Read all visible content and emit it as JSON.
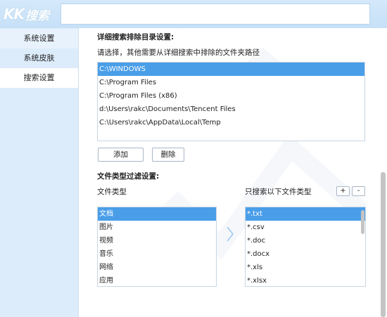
{
  "app": {
    "logo_kk": "KK",
    "logo_text": "搜索",
    "search_value": ""
  },
  "sidebar": {
    "items": [
      {
        "label": "系统设置"
      },
      {
        "label": "系统皮肤"
      },
      {
        "label": "搜索设置"
      }
    ]
  },
  "exclude": {
    "title": "详细搜索排除目录设置:",
    "hint": "请选择，其他需要从详细搜索中排除的文件夹路径",
    "paths": [
      "C:\\WINDOWS",
      "C:\\Program Files",
      "C:\\Program Files (x86)",
      "d:\\Users\\rakc\\Documents\\Tencent Files",
      "C:\\Users\\rakc\\AppData\\Local\\Temp"
    ],
    "add_label": "添加",
    "delete_label": "删除"
  },
  "filter": {
    "title": "文件类型过滤设置:",
    "left_label": "文件类型",
    "right_label": "只搜索以下文件类型",
    "plus_label": "+",
    "minus_label": "-",
    "types": [
      "文档",
      "图片",
      "视频",
      "音乐",
      "网络",
      "应用"
    ],
    "extensions": [
      "*.txt",
      "*.csv",
      "*.doc",
      "*.docx",
      "*.xls",
      "*.xlsx"
    ]
  },
  "colors": {
    "accent": "#4a9ee8",
    "sidebar_bg": "#dcecfb",
    "titlebar_bg": "#c6e0f7"
  }
}
